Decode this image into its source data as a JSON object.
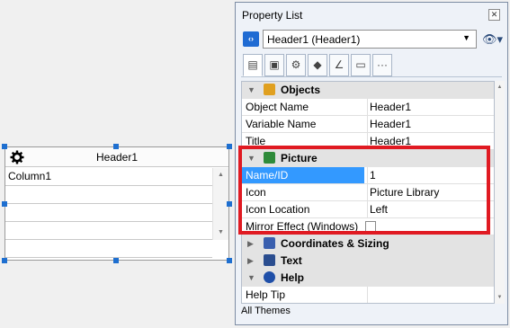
{
  "widget": {
    "header_title": "Header1",
    "gear_icon": "gear-icon",
    "rows": [
      "Column1",
      "",
      "",
      "",
      ""
    ]
  },
  "panel": {
    "title": "Property List",
    "close_label": "✕",
    "object_selector": {
      "nav_icon": "‹›",
      "value": "Header1 (Header1)"
    },
    "eye_label": "👁▾",
    "toolbar_tabs": [
      {
        "name": "properties-tab",
        "glyph": "▤"
      },
      {
        "name": "appearance-tab",
        "glyph": "▣"
      },
      {
        "name": "settings-tab",
        "glyph": "⚙"
      },
      {
        "name": "shapes-tab",
        "glyph": "◆"
      },
      {
        "name": "chart-tab",
        "glyph": "∠"
      },
      {
        "name": "display-tab",
        "glyph": "▭"
      },
      {
        "name": "more-tab",
        "glyph": "···"
      }
    ],
    "sections": {
      "objects": {
        "label": "Objects",
        "icon_color": "#e0a020"
      },
      "picture": {
        "label": "Picture",
        "icon_color": "#2e8b3a"
      },
      "coordinates": {
        "label": "Coordinates & Sizing",
        "icon_color": "#3a5fae"
      },
      "text": {
        "label": "Text",
        "icon_color": "#2a4d8f"
      },
      "help": {
        "label": "Help",
        "icon_color": "#1f4fa8"
      }
    },
    "objects_rows": [
      {
        "name": "Object Name",
        "value": "Header1"
      },
      {
        "name": "Variable Name",
        "value": "Header1"
      },
      {
        "name": "Title",
        "value": "Header1"
      }
    ],
    "picture_rows": [
      {
        "name": "Name/ID",
        "value": "1"
      },
      {
        "name": "Icon",
        "value": "Picture Library"
      },
      {
        "name": "Icon Location",
        "value": "Left"
      },
      {
        "name": "Mirror Effect (Windows)",
        "value": ""
      }
    ],
    "help_rows": [
      {
        "name": "Help Tip",
        "value": ""
      }
    ],
    "footer": "All Themes",
    "highlight_color": "#e01a22"
  }
}
